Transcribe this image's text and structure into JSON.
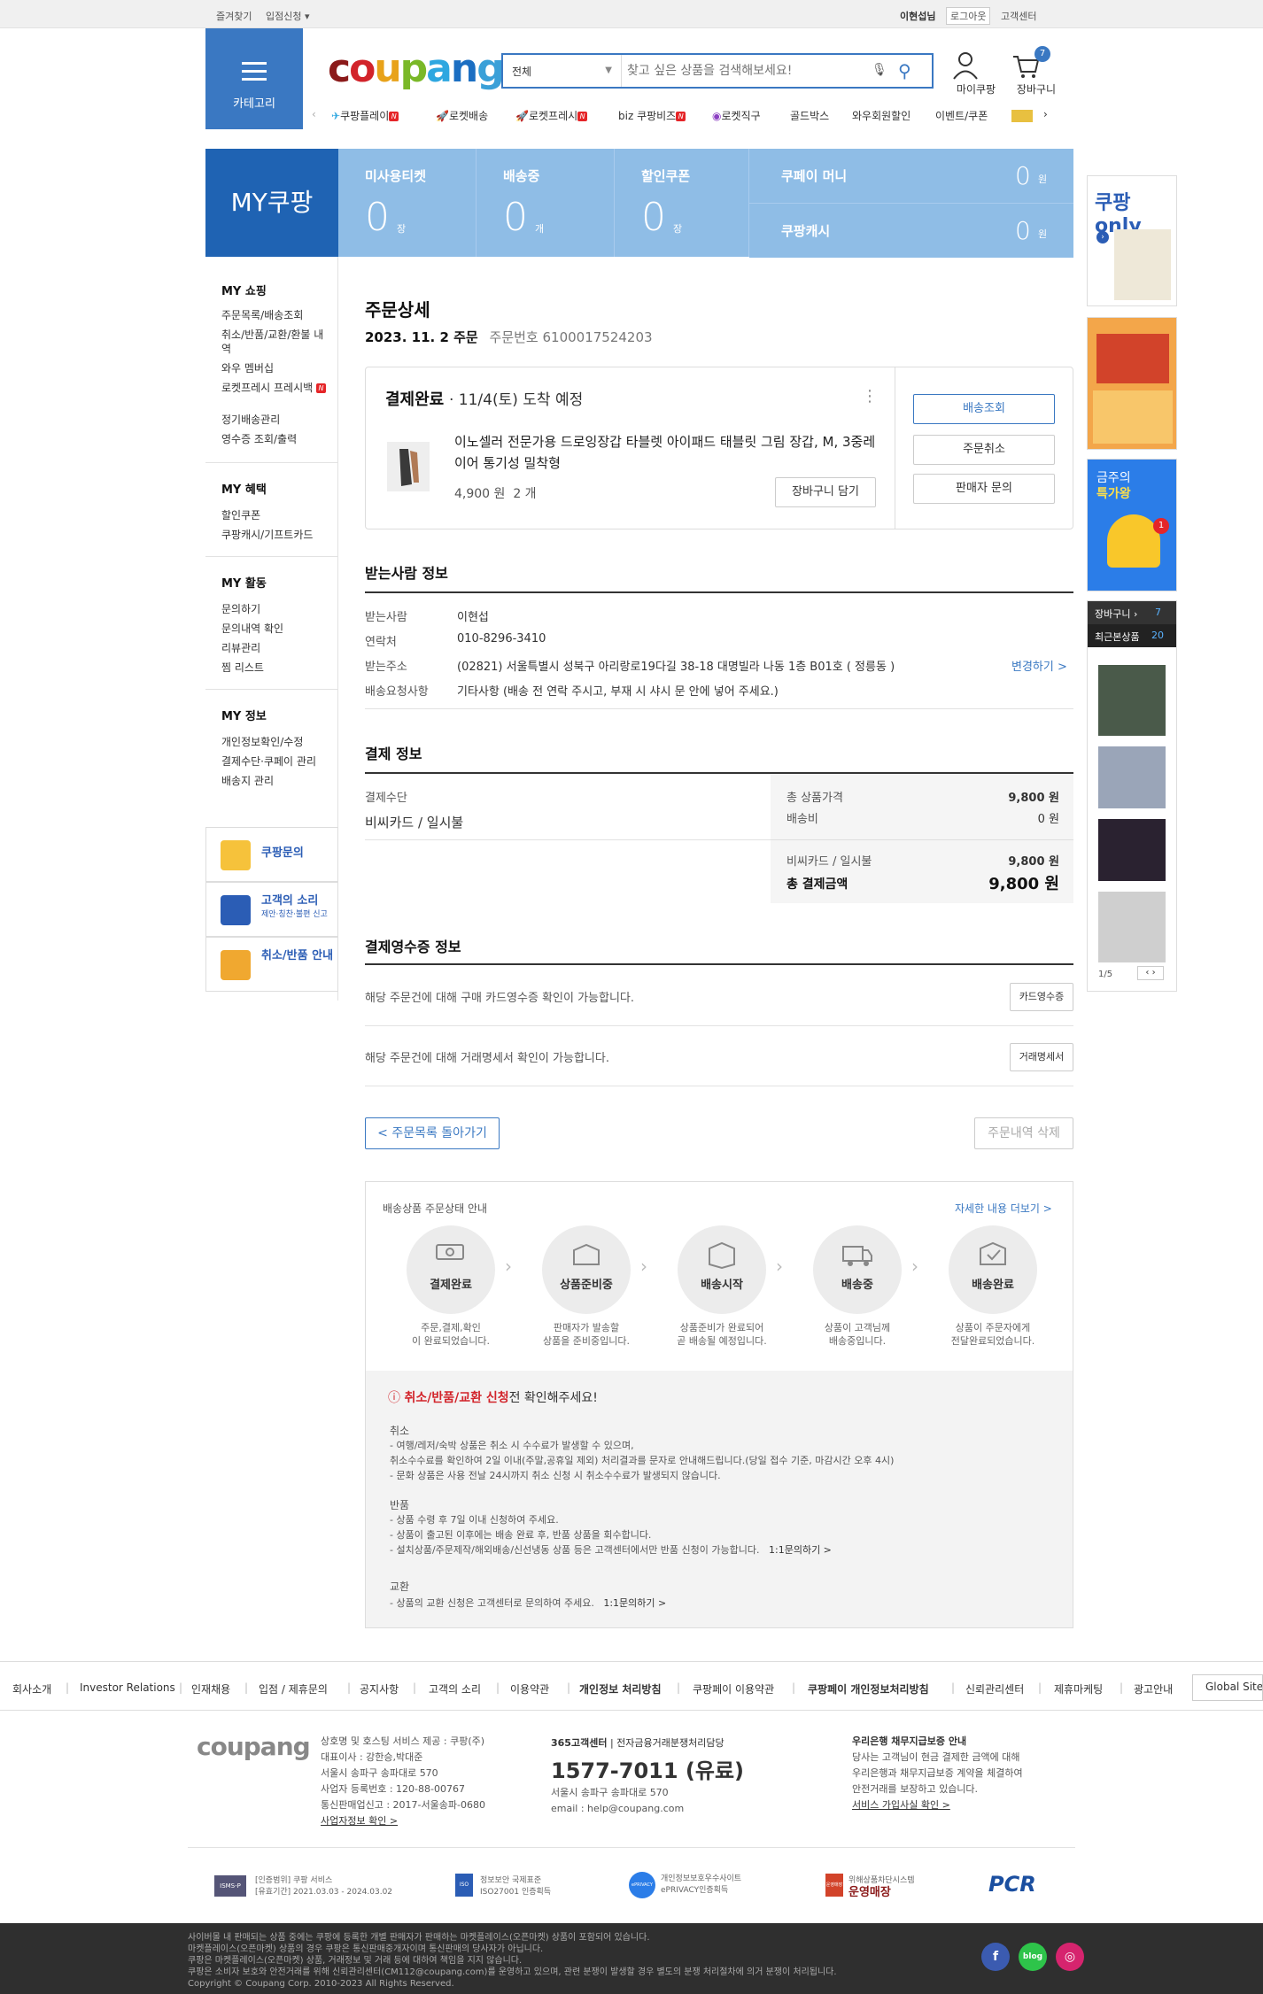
{
  "topbar": {
    "bookmark": "즐겨찾기",
    "seller": "입점신청 ▾",
    "user": "이현섭님",
    "logout": "로그아웃",
    "service": "고객센터"
  },
  "header": {
    "category": "카테고리",
    "logo": [
      "c",
      "o",
      "u",
      "p",
      "a",
      "n",
      "g"
    ],
    "search_category": "전체",
    "search_placeholder": "찾고 싶은 상품을 검색해보세요!",
    "mypage": "마이쿠팡",
    "cart": "장바구니",
    "cart_count": "7"
  },
  "nav": [
    {
      "label": "쿠팡플레이",
      "badge": "N"
    },
    {
      "label": "로켓배송",
      "badge": ""
    },
    {
      "label": "로켓프레시",
      "badge": "N"
    },
    {
      "label": "biz 쿠팡비즈",
      "badge": "N"
    },
    {
      "label": "로켓직구",
      "badge": ""
    },
    {
      "label": "골드박스",
      "badge": ""
    },
    {
      "label": "와우회원할인",
      "badge": ""
    },
    {
      "label": "이벤트/쿠폰",
      "badge": ""
    }
  ],
  "banner": {
    "title": "MY쿠팡",
    "tiles": [
      {
        "title": "미사용티켓",
        "value": "0",
        "unit": "장"
      },
      {
        "title": "배송중",
        "value": "0",
        "unit": "개"
      },
      {
        "title": "할인쿠폰",
        "value": "0",
        "unit": "장"
      }
    ],
    "money": [
      {
        "title": "쿠페이 머니",
        "value": "0",
        "unit": "원"
      },
      {
        "title": "쿠팡캐시",
        "value": "0",
        "unit": "원"
      }
    ]
  },
  "sidebar": {
    "sections": [
      {
        "title": "MY 쇼핑",
        "items": [
          "주문목록/배송조회",
          "취소/반품/교환/환불 내역",
          "와우 멤버십",
          "로켓프레시 프레시백",
          "정기배송관리",
          "영수증 조회/출력"
        ]
      },
      {
        "title": "MY 혜택",
        "items": [
          "할인쿠폰",
          "쿠팡캐시/기프트카드"
        ]
      },
      {
        "title": "MY 활동",
        "items": [
          "문의하기",
          "문의내역 확인",
          "리뷰관리",
          "찜 리스트"
        ]
      },
      {
        "title": "MY 정보",
        "items": [
          "개인정보확인/수정",
          "결제수단·쿠페이 관리",
          "배송지 관리"
        ]
      }
    ],
    "boxes": [
      {
        "title": "쿠팡문의",
        "sub": ""
      },
      {
        "title": "고객의 소리",
        "sub": "제안·칭찬·불편 신고"
      },
      {
        "title": "취소/반품 안내",
        "sub": ""
      }
    ]
  },
  "order": {
    "title": "주문상세",
    "date": "2023. 11. 2 주문",
    "number_label": "주문번호",
    "number": "6100017524203",
    "status": "결제완료",
    "eta": "· 11/4(토) 도착 예정",
    "product": "이노셀러 전문가용 드로잉장갑 타블렛 아이패드 태블릿 그림 장갑, M, 3중레이어 통기성 밀착형",
    "price": "4,900 원",
    "qty": "2 개",
    "cart_btn": "장바구니 담기",
    "track_btn": "배송조회",
    "cancel_btn": "주문취소",
    "ask_btn": "판매자 문의",
    "more": "⋮"
  },
  "receiver": {
    "title": "받는사람 정보",
    "rows": [
      {
        "label": "받는사람",
        "value": "이현섭"
      },
      {
        "label": "연락처",
        "value": "010-8296-3410"
      },
      {
        "label": "받는주소",
        "value": "(02821) 서울특별시 성북구 아리랑로19다길 38-18 대명빌라 나동 1층 B01호 ( 정릉동 )"
      },
      {
        "label": "배송요청사항",
        "value": "기타사항 (배송 전 연락 주시고, 부재 시 샤시 문 안에 넣어 주세요.)"
      }
    ],
    "change": "변경하기 >"
  },
  "payment": {
    "title": "결제 정보",
    "method_label": "결제수단",
    "method": "비씨카드 / 일시불",
    "price_label": "총 상품가격",
    "price": "9,800 원",
    "ship_label": "배송비",
    "ship": "0 원",
    "card_label": "비씨카드 / 일시불",
    "card": "9,800 원",
    "total_label": "총 결제금액",
    "total": "9,800 원"
  },
  "receipt": {
    "title": "결제영수증 정보",
    "line1": "해당 주문건에 대해 구매 카드영수증 확인이 가능합니다.",
    "btn1": "카드영수증",
    "line2": "해당 주문건에 대해 거래명세서 확인이 가능합니다.",
    "btn2": "거래명세서"
  },
  "actions": {
    "back": "< 주문목록 돌아가기",
    "delete": "주문내역 삭제"
  },
  "steps": {
    "title": "배송상품 주문상태 안내",
    "more": "자세한 내용 더보기 >",
    "items": [
      {
        "label": "결제완료",
        "desc1": "주문,결제,확인",
        "desc2": "이 완료되었습니다."
      },
      {
        "label": "상품준비중",
        "desc1": "판매자가 발송할",
        "desc2": "상품을 준비중입니다."
      },
      {
        "label": "배송시작",
        "desc1": "상품준비가 완료되어",
        "desc2": "곧 배송될 예정입니다."
      },
      {
        "label": "배송중",
        "desc1": "상품이 고객님께",
        "desc2": "배송중입니다."
      },
      {
        "label": "배송완료",
        "desc1": "상품이 주문자에게",
        "desc2": "전달완료되었습니다."
      }
    ]
  },
  "notice": {
    "head_red": "취소/반품/교환 신청",
    "head_rest": "전 확인해주세요!",
    "cancel_title": "취소",
    "cancel": [
      "- 여행/레저/숙박 상품은 취소 시 수수료가 발생할 수 있으며,",
      "  취소수수료를 확인하여 2일 이내(주말,공휴일 제외) 처리결과를 문자로 안내해드립니다.(당일 접수 기준, 마감시간 오후 4시)",
      "- 문화 상품은 사용 전날 24시까지 취소 신청 시 취소수수료가 발생되지 않습니다."
    ],
    "return_title": "반품",
    "return": [
      "- 상품 수령 후 7일 이내 신청하여 주세요.",
      "- 상품이 출고된 이후에는 배송 완료 후, 반품 상품을 회수합니다.",
      "- 설치상품/주문제작/해외배송/신선냉동 상품 등은 고객센터에서만 반품 신청이 가능합니다."
    ],
    "return_link": "1:1문의하기 >",
    "exchange_title": "교환",
    "exchange": "- 상품의 교환 신청은 고객센터로 문의하여 주세요.",
    "exchange_link": "1:1문의하기 >"
  },
  "rail": {
    "coupang_only": "쿠팡only",
    "weekly": "금주의",
    "weekly2": "특가왕",
    "cart": "장바구니 ›",
    "cart_count": "7",
    "recent": "최근본상품",
    "recent_count": "20",
    "page": "1/5"
  },
  "footer": {
    "nav": [
      "회사소개",
      "Investor Relations",
      "인재채용",
      "입점 / 제휴문의",
      "공지사항",
      "고객의 소리",
      "이용약관",
      "개인정보 처리방침",
      "쿠팡페이 이용약관",
      "쿠팡페이 개인정보처리방침",
      "신뢰관리센터",
      "제휴마케팅",
      "광고안내"
    ],
    "global": "Global Site",
    "logo": "coupang",
    "company": [
      "상호명 및 호스팅 서비스 제공 : 쿠팡(주)",
      "대표이사 : 강한승,박대준",
      "서울시 송파구 송파대로 570",
      "사업자 등록번호 : 120-88-00767",
      "통신판매업신고 : 2017-서울송파-0680",
      "사업자정보 확인 >"
    ],
    "cs_title": "365고객센터",
    "cs_sub": " | 전자금융거래분쟁처리담당",
    "cs_phone": "1577-7011 (유료)",
    "cs_addr": "서울시 송파구 송파대로 570",
    "cs_email": "email : help@coupang.com",
    "bank_title": "우리은행 채무지급보증 안내",
    "bank": [
      "당사는 고객님이 현금 결제한 금액에 대해",
      "우리은행과 채무지급보증 계약을 체결하여",
      "안전거래를 보장하고 있습니다."
    ],
    "bank_link": "서비스 가입사실 확인 >",
    "certs": [
      {
        "title": "ISMS-P",
        "l1": "[인증범위] 쿠팡 서비스",
        "l2": "[유효기간] 2021.03.03 - 2024.03.02"
      },
      {
        "title": "ISO",
        "l1": "정보보안 국제표준",
        "l2": "ISO27001 인증획득"
      },
      {
        "title": "ePRIVACY",
        "l1": "개인정보보호우수사이트",
        "l2": "ePRIVACY인증획득"
      },
      {
        "title": "운영매장",
        "l1": "위해상품차단시스템",
        "l2": "운영매장"
      },
      {
        "title": "PCR",
        "l1": "",
        "l2": ""
      }
    ],
    "bottom": [
      "사이버몰 내 판매되는 상품 중에는 쿠팡에 등록한 개별 판매자가 판매하는 마켓플레이스(오픈마켓) 상품이 포함되어 있습니다.",
      "마켓플레이스(오픈마켓) 상품의 경우 쿠팡은 통신판매중개자이며 통신판매의 당사자가 아닙니다.",
      "쿠팡은 마켓플레이스(오픈마켓) 상품, 거래정보 및 거래 등에 대하여 책임을 지지 않습니다.",
      "쿠팡은 소비자 보호와 안전거래를 위해 신뢰관리센터(CM112@coupang.com)를 운영하고 있으며, 관련 분쟁이 발생할 경우 별도의 분쟁 처리절차에 의거 분쟁이 처리됩니다.",
      "Copyright © Coupang Corp. 2010-2023 All Rights Reserved."
    ]
  },
  "colors": {
    "accent": "#3a78c2",
    "tile": "#8fbde6",
    "banner": "#1f63b3",
    "red": "#d2232a"
  }
}
